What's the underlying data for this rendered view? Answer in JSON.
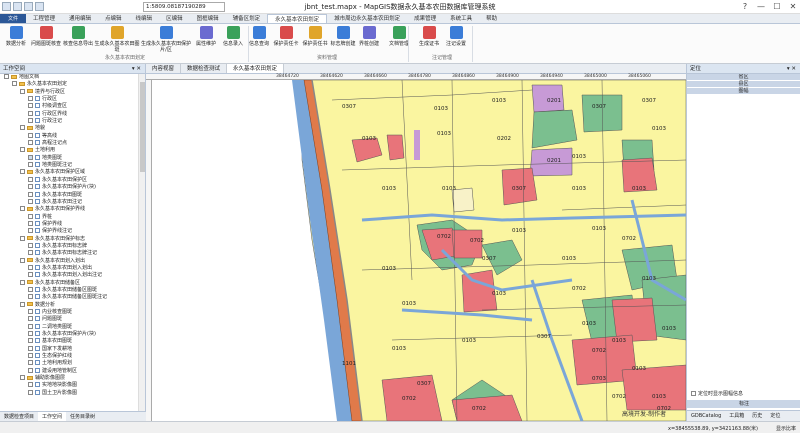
{
  "window": {
    "title": "jbnt_test.mapx - MapGIS数据永久基本农田数据库管理系统",
    "coord_input": "1:5809.08187190289",
    "controls": [
      "?",
      "—",
      "☐",
      "✕"
    ]
  },
  "menu": {
    "file_label": "文件",
    "tabs": [
      "工程管理",
      "通用编辑",
      "点编辑",
      "线编辑",
      "区编辑",
      "图框编辑",
      "辅备区划定",
      "永久基本农田划定",
      "城市周边永久基本农田划定",
      "成果管理",
      "系统工具",
      "帮助"
    ],
    "active": 7
  },
  "ribbon": {
    "buttons": [
      "数据分析",
      "问题图斑核查",
      "核查信息导出",
      "生成永久基本农田图斑",
      "生成永久基本农田保护片/区",
      "属性维护",
      "信息录入",
      "信息查询",
      "保护责任卡",
      "保护责任书",
      "标志牌创建",
      "界桩创建",
      "文档管理",
      "生成证书",
      "注记设置"
    ],
    "groups": [
      "永久基本农田划定",
      "资料管理",
      "注记管理"
    ]
  },
  "left_panel": {
    "title": "工作空间",
    "tree": [
      {
        "level": 0,
        "kind": "folder",
        "label": "地图文档"
      },
      {
        "level": 1,
        "kind": "folder",
        "label": "永久基本农田划定"
      },
      {
        "level": 2,
        "kind": "folder",
        "label": "境界与行政区"
      },
      {
        "level": 3,
        "kind": "layer",
        "label": "行政区"
      },
      {
        "level": 3,
        "kind": "layer",
        "label": "村级调查区"
      },
      {
        "level": 3,
        "kind": "layer",
        "label": "行政区界线"
      },
      {
        "level": 3,
        "kind": "layer",
        "label": "行政注记"
      },
      {
        "level": 2,
        "kind": "folder",
        "label": "地貌"
      },
      {
        "level": 3,
        "kind": "layer",
        "label": "等高线"
      },
      {
        "level": 3,
        "kind": "layer",
        "label": "高程注记点"
      },
      {
        "level": 2,
        "kind": "folder",
        "label": "土地利用"
      },
      {
        "level": 3,
        "kind": "layer",
        "label": "地类图斑",
        "checked": true
      },
      {
        "level": 3,
        "kind": "layer",
        "label": "地类图斑注记"
      },
      {
        "level": 2,
        "kind": "folder",
        "label": "永久基本农田保护区域"
      },
      {
        "level": 3,
        "kind": "layer",
        "label": "永久基本农田保护区"
      },
      {
        "level": 3,
        "kind": "layer",
        "label": "永久基本农田保护片(块)"
      },
      {
        "level": 3,
        "kind": "layer",
        "label": "永久基本农田图斑"
      },
      {
        "level": 3,
        "kind": "layer",
        "label": "永久基本农田注记"
      },
      {
        "level": 2,
        "kind": "folder",
        "label": "永久基本农田保护界线"
      },
      {
        "level": 3,
        "kind": "layer",
        "label": "界桩"
      },
      {
        "level": 3,
        "kind": "layer",
        "label": "保护界线"
      },
      {
        "level": 3,
        "kind": "layer",
        "label": "保护界线注记"
      },
      {
        "level": 2,
        "kind": "folder",
        "label": "永久基本农田保护标志"
      },
      {
        "level": 3,
        "kind": "layer",
        "label": "永久基本农田标志牌"
      },
      {
        "level": 3,
        "kind": "layer",
        "label": "永久基本农田标志牌注记"
      },
      {
        "level": 2,
        "kind": "folder",
        "label": "永久基本农田划入划出"
      },
      {
        "level": 3,
        "kind": "layer",
        "label": "永久基本农田划入划出"
      },
      {
        "level": 3,
        "kind": "layer",
        "label": "永久基本农田划入划出注记"
      },
      {
        "level": 2,
        "kind": "folder",
        "label": "永久基本农田储备区"
      },
      {
        "level": 3,
        "kind": "layer",
        "label": "永久基本农田储备区图斑"
      },
      {
        "level": 3,
        "kind": "layer",
        "label": "永久基本农田储备区图斑注记"
      },
      {
        "level": 2,
        "kind": "folder",
        "label": "数据分析"
      },
      {
        "level": 3,
        "kind": "layer",
        "label": "内业核查图斑"
      },
      {
        "level": 3,
        "kind": "layer",
        "label": "问题图斑"
      },
      {
        "level": 3,
        "kind": "layer",
        "label": "二调地类图斑"
      },
      {
        "level": 3,
        "kind": "layer",
        "label": "永久基本农田保护片(块)"
      },
      {
        "level": 3,
        "kind": "layer",
        "label": "基本农田图斑"
      },
      {
        "level": 3,
        "kind": "layer",
        "label": "国家下发耕地"
      },
      {
        "level": 3,
        "kind": "layer",
        "label": "生态保护红线"
      },
      {
        "level": 3,
        "kind": "layer",
        "label": "土地利用规划"
      },
      {
        "level": 3,
        "kind": "layer",
        "label": "建设用地管制区"
      },
      {
        "level": 2,
        "kind": "folder",
        "label": "辅助影像图层"
      },
      {
        "level": 3,
        "kind": "layer",
        "label": "实地地块影像图"
      },
      {
        "level": 3,
        "kind": "layer",
        "label": "国土卫片影像图"
      }
    ],
    "bottom_tabs": [
      "数据检查项目",
      "工作空间",
      "任务目录树"
    ],
    "bottom_active": 1
  },
  "doc_tabs": [
    "内容视窗",
    "数据检查测试",
    "永久基本农田划定"
  ],
  "doc_active": 2,
  "map": {
    "ruler_coords": [
      "38464720",
      "38464620",
      "38464660",
      "38464780",
      "38464860",
      "38464900",
      "38464940",
      "38465000",
      "38465060"
    ],
    "parcel_labels": [
      "0307",
      "0103",
      "0103",
      "0201",
      "0307",
      "0307",
      "0103",
      "0103",
      "0202",
      "0103",
      "0103",
      "0103",
      "0103",
      "0307",
      "0103",
      "0201",
      "0103",
      "0103",
      "0103",
      "0702",
      "0702",
      "0103",
      "0307",
      "0103",
      "0702",
      "0103",
      "0103",
      "0702",
      "0103",
      "0103",
      "0103",
      "0307",
      "0103",
      "0103",
      "0103",
      "0702",
      "0103",
      "1101",
      "0702",
      "0702",
      "0307",
      "0703",
      "0702",
      "0103",
      "0702"
    ],
    "watermark": "高境开发-制作者",
    "colors": {
      "farmland": "#faf5a0",
      "red_zone": "#e8747a",
      "green": "#7bbf8f",
      "purple": "#c79ad6",
      "road": "#e07a4a",
      "river": "#7aa6d8",
      "cream": "#f8f2c8"
    }
  },
  "right_panel": {
    "title": "定位",
    "subheads": [
      "省区",
      "县区",
      "图幅"
    ],
    "checkbox_label": "定位时显示图幅信息",
    "mark_title": "标注",
    "bottom_tabs": [
      "GDBCatalog",
      "工具箱",
      "历史",
      "定位"
    ]
  },
  "status": {
    "coords": "x=38455538.89, y=3421163.88(米)",
    "scale_label": "显示比率"
  }
}
